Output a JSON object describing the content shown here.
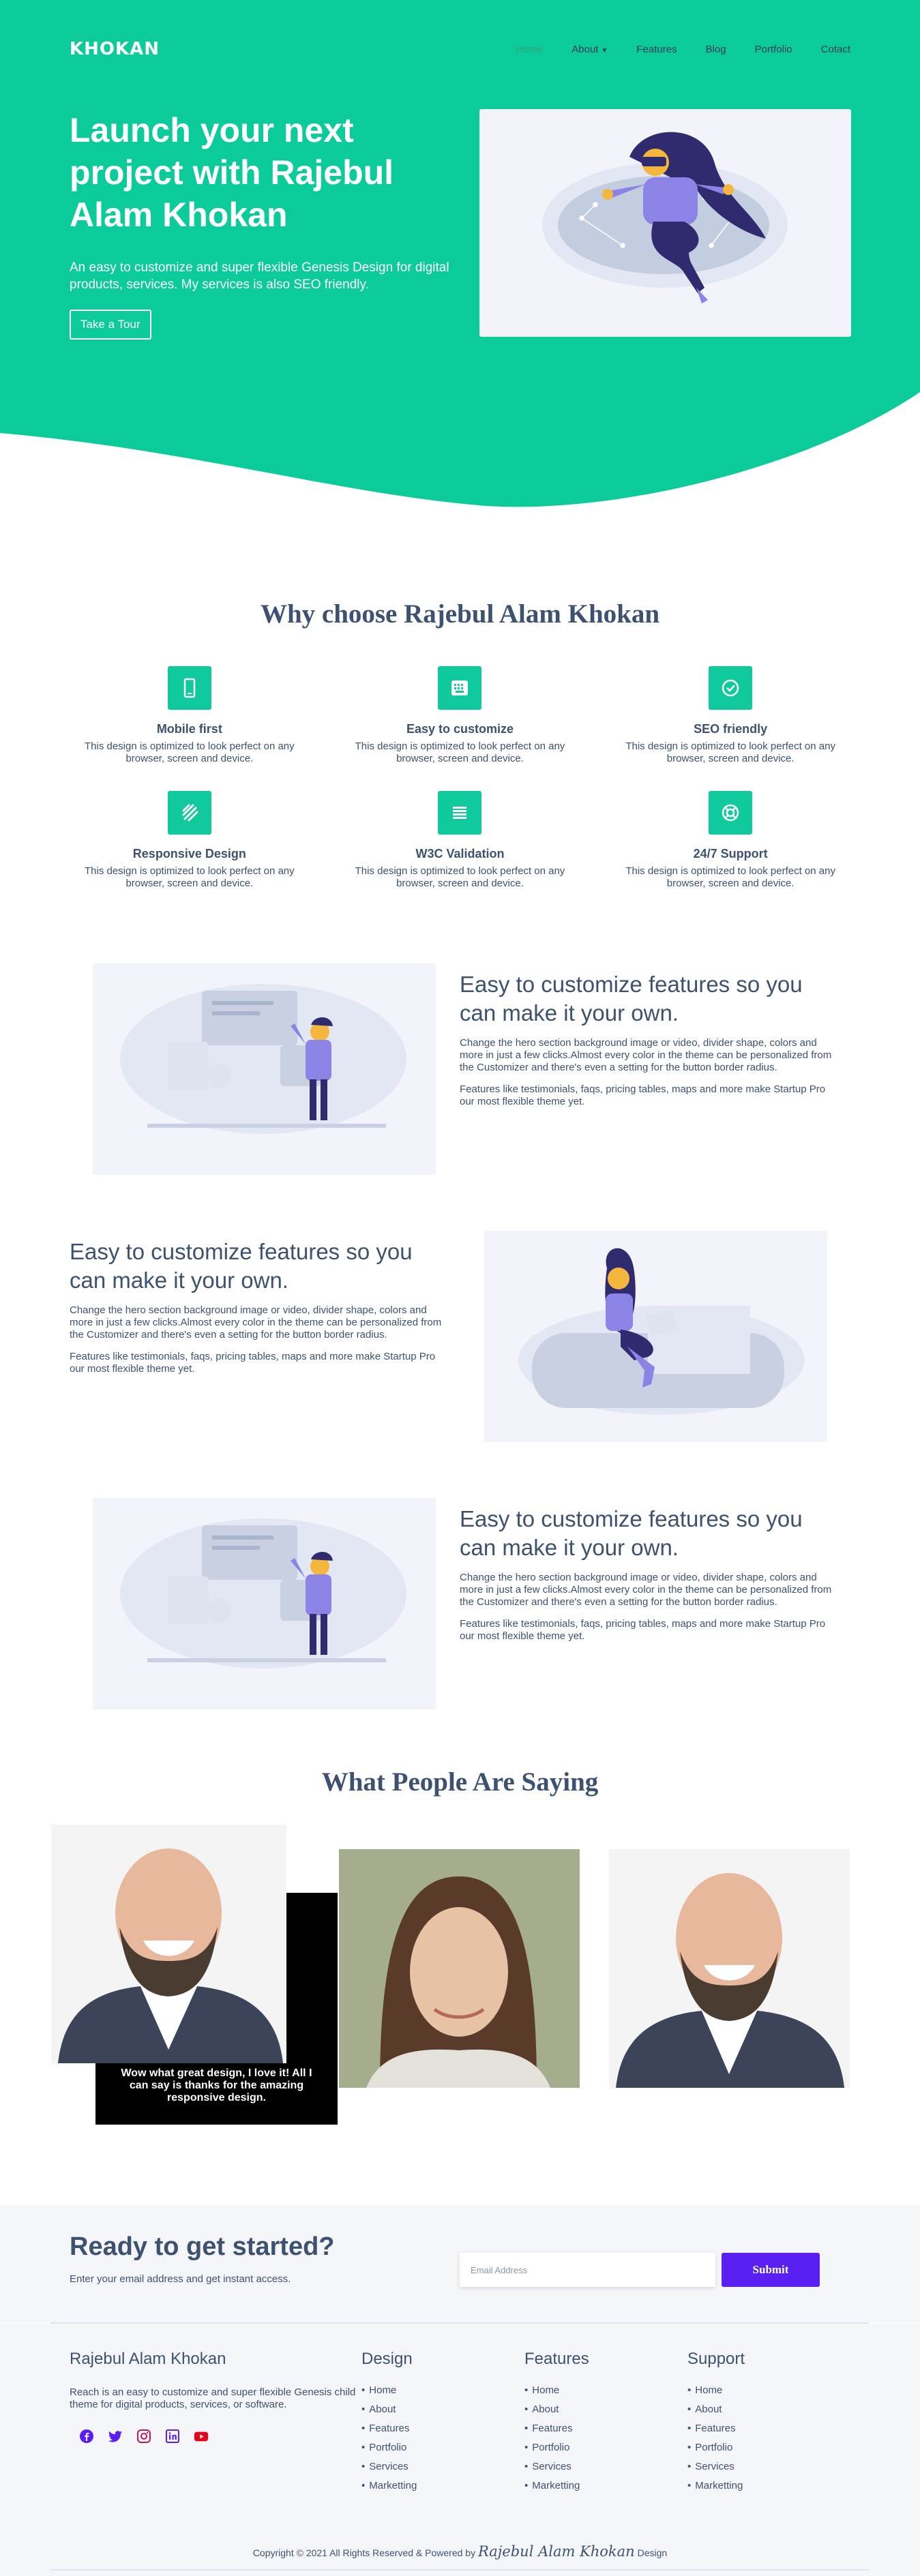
{
  "colors": {
    "accent": "#0ccb9a",
    "primary_text": "#3d5170",
    "submit": "#5a1ff2",
    "illustration_bg": "#f3f4fb"
  },
  "header": {
    "logo": "KHOKAN",
    "menu": [
      {
        "label": "Home",
        "active": true
      },
      {
        "label": "About",
        "has_dropdown": true
      },
      {
        "label": "Features"
      },
      {
        "label": "Blog"
      },
      {
        "label": "Portfolio"
      },
      {
        "label": "Cotact"
      }
    ]
  },
  "hero": {
    "title": "Launch your next project with Rajebul Alam Khokan",
    "description": "An easy to customize and super flexible Genesis Design for digital products, services. My services is also SEO friendly.",
    "button": "Take a Tour"
  },
  "why": {
    "title": "Why choose Rajebul Alam Khokan",
    "features": [
      {
        "icon": "mobile-icon",
        "title": "Mobile first",
        "text": "This design is optimized to look perfect on any browser, screen and device."
      },
      {
        "icon": "keyboard-icon",
        "title": "Easy to customize",
        "text": "This design is optimized to look perfect on any browser, screen and device."
      },
      {
        "icon": "check-circle-icon",
        "title": "SEO friendly",
        "text": "This design is optimized to look perfect on any browser, screen and device."
      },
      {
        "icon": "layers-icon",
        "title": "Responsive Design",
        "text": "This design is optimized to look perfect on any browser, screen and device."
      },
      {
        "icon": "list-icon",
        "title": "W3C Validation",
        "text": "This design is optimized to look perfect on any browser, screen and device."
      },
      {
        "icon": "lifebuoy-icon",
        "title": "24/7 Support",
        "text": "This design is optimized to look perfect on any browser, screen and device."
      }
    ]
  },
  "sections": [
    {
      "title": "Easy to customize features so you can make it your own.",
      "p1": "Change the hero section background image or video, divider shape, colors and more in just a few clicks.Almost every color in the theme can be personalized from the Customizer and there's even a setting for the button border radius.",
      "p2": "Features like testimonials, faqs, pricing tables, maps and more make Startup Pro our most flexible theme yet."
    },
    {
      "title": "Easy to customize features so you can make it your own.",
      "p1": "Change the hero section background image or video, divider shape, colors and more in just a few clicks.Almost every color in the theme can be personalized from the Customizer and there's even a setting for the button border radius.",
      "p2": "Features like testimonials, faqs, pricing tables, maps and more make Startup Pro our most flexible theme yet."
    },
    {
      "title": "Easy to customize features so you can make it your own.",
      "p1": "Change the hero section background image or video, divider shape, colors and more in just a few clicks.Almost every color in the theme can be personalized from the Customizer and there's even a setting for the button border radius.",
      "p2": "Features like testimonials, faqs, pricing tables, maps and more make Startup Pro our most flexible theme yet."
    }
  ],
  "testimonials": {
    "title": "What People Are Saying",
    "quote": "Wow what great design, I love it! All I can say is thanks for the amazing responsive design."
  },
  "cta": {
    "title": "Ready to get started?",
    "subtitle": "Enter your email address and get instant access.",
    "placeholder": "Email Address",
    "button": "Submit"
  },
  "footer": {
    "about_title": "Rajebul Alam Khokan",
    "about_text": "Reach is an easy to customize and super flexible Genesis child theme for digital products, services, or software.",
    "socials": [
      "facebook-icon",
      "twitter-icon",
      "instagram-icon",
      "linkedin-icon",
      "youtube-icon"
    ],
    "columns": [
      {
        "title": "Design",
        "items": [
          "Home",
          "About",
          "Features",
          "Portfolio",
          "Services",
          "Marketting"
        ]
      },
      {
        "title": "Features",
        "items": [
          "Home",
          "About",
          "Features",
          "Portfolio",
          "Services",
          "Marketting"
        ]
      },
      {
        "title": "Support",
        "items": [
          "Home",
          "About",
          "Features",
          "Portfolio",
          "Services",
          "Marketting"
        ]
      }
    ],
    "copyright_prefix": "Copyright © 2021 All Rights Reserved & Powered by",
    "copyright_brand": "Rajebul Alam Khokan",
    "copyright_suffix": "Design"
  }
}
